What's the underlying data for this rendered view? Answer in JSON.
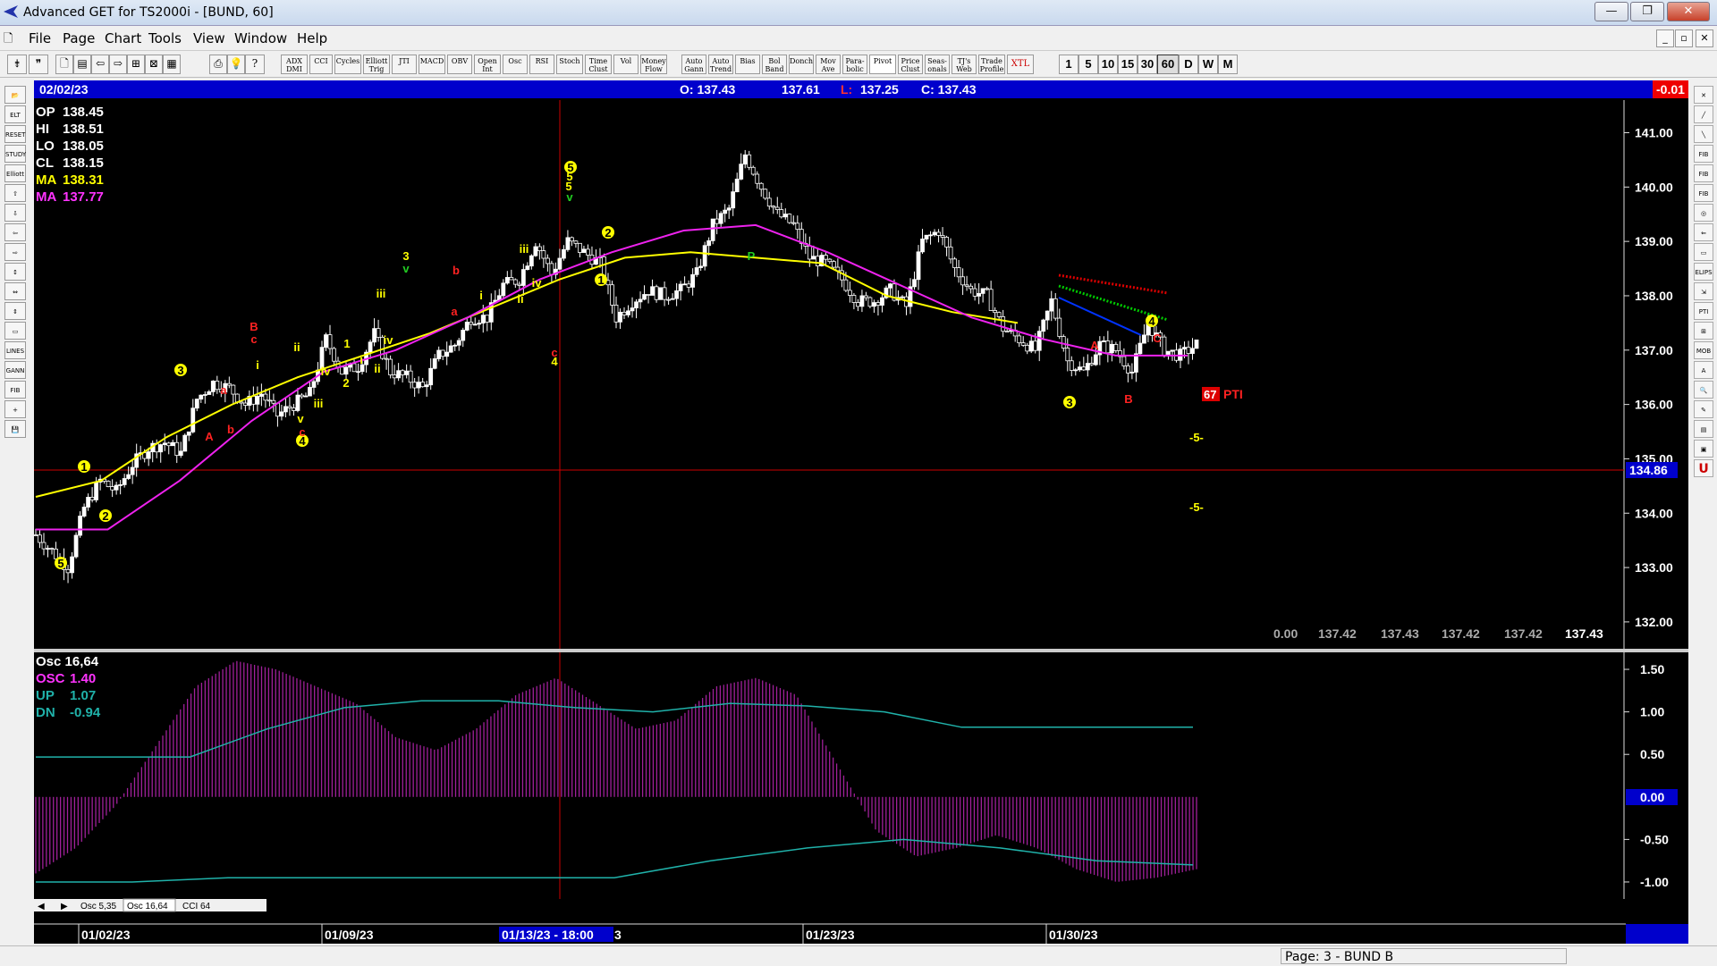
{
  "window": {
    "title": "Advanced GET for TS2000i - [BUND, 60]",
    "min_label": "—",
    "max_label": "❐",
    "close_label": "✕"
  },
  "menu": {
    "items": [
      "File",
      "Page",
      "Chart",
      "Tools",
      "View",
      "Window",
      "Help"
    ],
    "mdi_min": "_",
    "mdi_restore": "▫",
    "mdi_close": "✕"
  },
  "toolbar": {
    "studies": [
      "ADX DMI",
      "CCI",
      "Cycles",
      "Elliott Trig",
      "JTI",
      "MACD",
      "OBV",
      "Open Int",
      "Osc",
      "RSI",
      "Stoch",
      "Time Clust",
      "Vol",
      "Money Flow",
      "Auto Gann",
      "Auto Trend",
      "Bias",
      "Bol Band",
      "Donch",
      "Mov Ave",
      "Para- bolic",
      "Pivot",
      "Price Clust",
      "Seas- onals",
      "TJ's Web",
      "Trade Profile",
      "XTL"
    ],
    "periods": [
      "1",
      "5",
      "10",
      "15",
      "30",
      "60",
      "D",
      "W",
      "M"
    ],
    "selected_period": "60"
  },
  "left_tools": [
    "📂",
    "ELT",
    "RESET",
    "STUDY",
    "Elliott",
    "⇧",
    "⇩",
    "⇦",
    "⇨",
    "↕",
    "⇔",
    "⇕",
    "▭",
    "LINES",
    "GANN",
    "FIB",
    "+",
    "💾"
  ],
  "right_tools": [
    "✕",
    "╱",
    "╲",
    "FIB RET",
    "FIB EXT",
    "FIB TIME",
    "◎",
    "⇐",
    "▭",
    "ELIPS",
    "⇲",
    "PTI",
    "⊞",
    "MOB",
    "A",
    "🔍",
    "✎",
    "▤",
    "▣",
    "U"
  ],
  "price_panel": {
    "header_date": "02/02/23",
    "header_open": "O: 137.43",
    "header_high": "137.61",
    "header_low_label": "L:",
    "header_low": "137.25",
    "header_close": "C: 137.43",
    "header_change": "-0.01",
    "info": [
      {
        "label": "OP",
        "value": "138.45",
        "color": "#ffffff"
      },
      {
        "label": "HI",
        "value": "138.51",
        "color": "#ffffff"
      },
      {
        "label": "LO",
        "value": "138.05",
        "color": "#ffffff"
      },
      {
        "label": "CL",
        "value": "138.15",
        "color": "#ffffff"
      },
      {
        "label": "MA",
        "value": "138.31",
        "color": "#ffff00"
      },
      {
        "label": "MA",
        "value": "137.77",
        "color": "#ff33ff"
      }
    ],
    "current_price": "134.86",
    "bottom_values": [
      "0.00",
      "137.42",
      "137.43",
      "137.42",
      "137.42",
      "137.43"
    ],
    "pti_value": "67",
    "pti_label": "PTI",
    "band_labels": [
      "-5-",
      "-5-"
    ]
  },
  "osc_panel": {
    "title": "Osc 16,64",
    "info": [
      {
        "label": "OSC",
        "value": "1.40",
        "color": "#ff33ff"
      },
      {
        "label": "UP",
        "value": "1.07",
        "color": "#20b2aa"
      },
      {
        "label": "DN",
        "value": "-0.94",
        "color": "#20b2aa"
      }
    ],
    "current_value": "0.00",
    "tabs": [
      "Osc 5,35",
      "Osc 16,64",
      "CCI 64"
    ],
    "active_tab": "Osc 16,64"
  },
  "date_axis": {
    "labels": [
      "01/02/23",
      "01/09/23",
      "01/13/23 - 18:00",
      "3",
      "01/23/23",
      "01/30/23"
    ]
  },
  "chart_data": [
    {
      "type": "candlestick",
      "title": "BUND, 60",
      "ylim": [
        131.9,
        141.6
      ],
      "yticks": [
        "141.00",
        "140.00",
        "139.00",
        "138.00",
        "137.00",
        "136.00",
        "135.00",
        "134.00",
        "133.00",
        "132.00"
      ],
      "xlabels": [
        "01/02/23",
        "01/09/23",
        "01/23/23",
        "01/30/23"
      ],
      "series": [
        {
          "name": "Price",
          "values": [
            133.6,
            133.3,
            133.0,
            134.1,
            134.6,
            134.4,
            134.9,
            135.2,
            135.3,
            135.1,
            136.1,
            136.4,
            136.3,
            136.0,
            136.2,
            135.8,
            136.0,
            136.2,
            137.2,
            136.6,
            136.7,
            137.3,
            136.6,
            136.5,
            136.3,
            136.9,
            137.1,
            137.6,
            137.6,
            138.2,
            138.3,
            139.0,
            138.4,
            139.0,
            138.8,
            138.6,
            137.6,
            137.9,
            138.1,
            138.0,
            138.1,
            138.4,
            139.3,
            139.6,
            140.6,
            140.0,
            139.5,
            139.3,
            138.7,
            138.6,
            138.3,
            137.9,
            137.9,
            138.1,
            137.8,
            139.0,
            139.2,
            138.5,
            138.1,
            138.0,
            137.4,
            137.2,
            137.0,
            137.9,
            136.8,
            136.6,
            137.1,
            137.0,
            136.6,
            137.5,
            137.0,
            136.9,
            137.1
          ]
        },
        {
          "name": "MA",
          "values": [
            134.3,
            134.6,
            135.4,
            136.0,
            136.5,
            136.9,
            137.3,
            137.8,
            138.3,
            138.7,
            138.8,
            138.7,
            138.6,
            138.0,
            137.7,
            137.5
          ]
        },
        {
          "name": "MA",
          "values": [
            133.7,
            133.7,
            134.6,
            135.7,
            136.6,
            137.0,
            137.6,
            138.3,
            138.8,
            139.2,
            139.3,
            138.8,
            138.2,
            137.6,
            137.2,
            136.9,
            136.9
          ]
        }
      ],
      "annotations": [
        "5",
        "1",
        "2",
        "3",
        "A",
        "a",
        "b",
        "B",
        "c",
        "i",
        "ii",
        "iii",
        "iv",
        "v",
        "4",
        "P",
        "67 PTI"
      ]
    },
    {
      "type": "bar",
      "title": "Osc 16,64",
      "ylim": [
        -1.2,
        1.7
      ],
      "yticks": [
        "1.50",
        "1.00",
        "0.50",
        "0.00",
        "-0.50",
        "-1.00"
      ],
      "series": [
        {
          "name": "OSC",
          "values": [
            -0.9,
            -0.6,
            -0.1,
            0.6,
            1.3,
            1.6,
            1.5,
            1.3,
            1.1,
            0.7,
            0.55,
            0.8,
            1.2,
            1.4,
            1.1,
            0.8,
            0.9,
            1.3,
            1.4,
            1.2,
            0.4,
            -0.4,
            -0.7,
            -0.6,
            -0.45,
            -0.6,
            -0.85,
            -1.0,
            -0.95,
            -0.85
          ]
        },
        {
          "name": "UP",
          "values": [
            0.47,
            0.47,
            0.47,
            0.8,
            1.05,
            1.13,
            1.13,
            1.05,
            1.0,
            1.1,
            1.07,
            1.0,
            0.82,
            0.82,
            0.82,
            0.82
          ]
        },
        {
          "name": "DN",
          "values": [
            -1.0,
            -1.0,
            -0.95,
            -0.95,
            -0.95,
            -0.95,
            -0.95,
            -0.75,
            -0.6,
            -0.5,
            -0.6,
            -0.75,
            -0.8
          ]
        }
      ]
    }
  ]
}
